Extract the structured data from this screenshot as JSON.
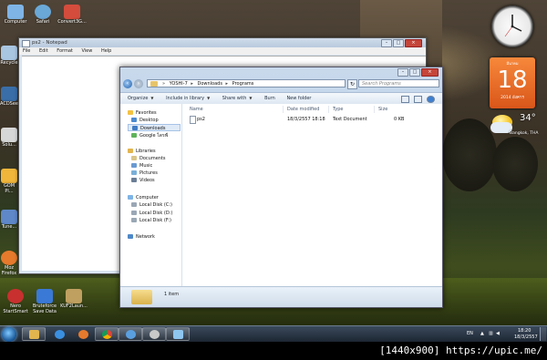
{
  "desktop": {
    "icons": [
      {
        "label": "Computer",
        "color": "#7fb4e6"
      },
      {
        "label": "Safari",
        "color": "#6aa8d8"
      },
      {
        "label": "Convert3G...",
        "color": "#d44c3c"
      },
      {
        "label": "Recycle",
        "color": "#a9c6e1"
      },
      {
        "label": "ACDSee",
        "color": "#3a6ea8"
      },
      {
        "label": "Solu...",
        "color": "#d7d7d7"
      },
      {
        "label": "GOM Pl...",
        "color": "#f0b63b"
      },
      {
        "label": "Tune...",
        "color": "#5f88c8"
      },
      {
        "label": "Moz Firefox",
        "color": "#e57a2d"
      },
      {
        "label": "Nero StartSmart",
        "color": "#c8302f"
      },
      {
        "label": "Bruteforce Save Data",
        "color": "#3a79d6"
      },
      {
        "label": "KUF2Laun...",
        "color": "#c0a060"
      }
    ]
  },
  "notepad": {
    "title": "ps2 - Notepad",
    "menu": [
      "File",
      "Edit",
      "Format",
      "View",
      "Help"
    ]
  },
  "explorer": {
    "address": [
      "YOSHI-7",
      "Downloads",
      "Programs"
    ],
    "search_placeholder": "Search Programs",
    "commands": [
      "Organize",
      "Include in library",
      "Share with",
      "Burn",
      "New folder"
    ],
    "nav": {
      "favorites_header": "Favorites",
      "favorites": [
        "Desktop",
        "Downloads",
        "Google ไดรฟ์"
      ],
      "libraries_header": "Libraries",
      "libraries": [
        "Documents",
        "Music",
        "Pictures",
        "Videos"
      ],
      "computer_header": "Computer",
      "drives": [
        "Local Disk (C:)",
        "Local Disk (D:)",
        "Local Disk (F:)"
      ],
      "network": "Network"
    },
    "columns": [
      "Name",
      "Date modified",
      "Type",
      "Size"
    ],
    "files": [
      {
        "name": "ps2",
        "date": "18/3/2557 18:18",
        "type": "Text Document",
        "size": "0 KB"
      }
    ],
    "status": "1 item"
  },
  "gadgets": {
    "calendar": {
      "month": "มีนาคม",
      "day": "18",
      "year": "2014 อังคาร"
    },
    "weather": {
      "temp": "34°",
      "city": "Bangkok, THA"
    }
  },
  "taskbar": {
    "lang": "EN",
    "time": "18:20",
    "date": "18/3/2557"
  },
  "caption": "[1440x900] https://upic.me/",
  "colors": {
    "accent": "#1d5fae",
    "calendar": "#e8692a",
    "close": "#c6453a"
  }
}
